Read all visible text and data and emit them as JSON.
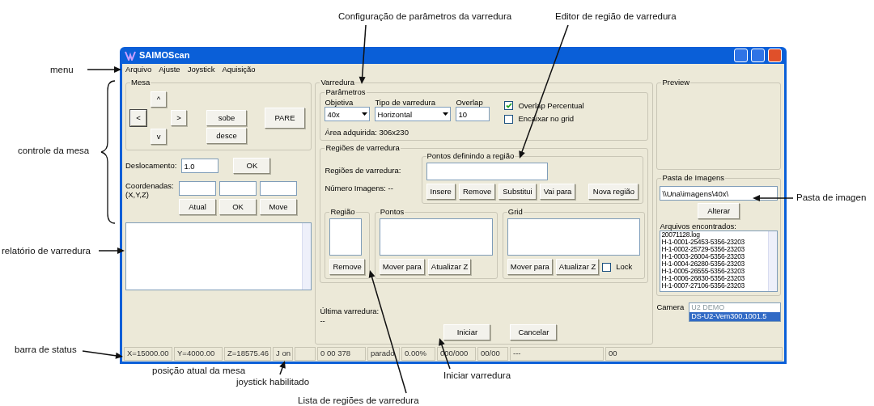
{
  "annotations": [
    {
      "text": "Configuração de parâmetros da varredura"
    },
    {
      "text": "Editor de região de varredura"
    },
    {
      "text": "menu"
    },
    {
      "text": "controle da mesa"
    },
    {
      "text": "relatório de varredura"
    },
    {
      "text": "Pasta de imagen"
    },
    {
      "text": "barra de status"
    },
    {
      "text": "posição atual da mesa"
    },
    {
      "text": "joystick habilitado"
    },
    {
      "text": "Iniciar varredura"
    },
    {
      "text": "Lista de regiões de varredura"
    }
  ],
  "window": {
    "title": "SAIMOScan"
  },
  "menu": [
    "Arquivo",
    "Ajuste",
    "Joystick",
    "Aquisição"
  ],
  "mesa": {
    "title": "Mesa",
    "arrows": [
      "^",
      "<",
      ">",
      "v"
    ],
    "buttons": [
      "sobe",
      "desce",
      "PARE"
    ]
  },
  "deslocamento": {
    "label": "Deslocamento:",
    "value": "1.0",
    "button": "OK"
  },
  "coordenadas": {
    "label": "Coordenadas:",
    "sublabel": "(X,Y,Z)",
    "buttons": [
      "Atual",
      "OK",
      "Move"
    ]
  },
  "varredura": {
    "title": "Varredura",
    "parametros": {
      "title": "Parâmetros",
      "fields": [
        {
          "label": "Objetiva",
          "value": "40x",
          "kind": "select"
        },
        {
          "label": "Tipo de varredura",
          "value": "Horizontal",
          "kind": "select"
        },
        {
          "label": "Overlap",
          "value": "10",
          "kind": "input"
        }
      ],
      "checkboxes": [
        {
          "label": "Overlap Percentual",
          "checked": true
        },
        {
          "label": "Encaixar no grid",
          "checked": false
        }
      ],
      "area": "Área adquirida: 306x230"
    },
    "regioes": {
      "title": "Regiões de varredura",
      "label": "Regiões de varredura:",
      "count": "Número Imagens: --",
      "pontos_definindo": {
        "title": "Pontos definindo a região",
        "buttons": [
          "Insere",
          "Remove",
          "Substitui",
          "Vai para",
          "Nova região"
        ]
      },
      "lists": [
        {
          "title": "Região",
          "buttons": [
            "Remove"
          ]
        },
        {
          "title": "Pontos",
          "buttons": [
            "Mover para",
            "Atualizar Z"
          ]
        },
        {
          "title": "Grid",
          "buttons": [
            "Mover para",
            "Atualizar Z"
          ],
          "lock": {
            "label": "Lock",
            "checked": false
          }
        }
      ]
    },
    "ultima": {
      "label": "Última varredura:",
      "value": "--"
    },
    "buttons": [
      "Iniciar",
      "Cancelar"
    ]
  },
  "preview": {
    "title": "Preview"
  },
  "pasta": {
    "title": "Pasta de Imagens",
    "value": "\\\\Una\\imagens\\40x\\",
    "button": "Alterar",
    "files_label": "Arquivos encontrados:",
    "files": [
      "20071128.log",
      "H-1-0001-25453-5356-23203",
      "H-1-0002-25729-5356-23203",
      "H-1-0003-26004-5356-23203",
      "H-1-0004-26280-5356-23203",
      "H-1-0005-26555-5356-23203",
      "H-1-0006-26830-5356-23203",
      "H-1-0007-27106-5356-23203"
    ]
  },
  "camera": {
    "label": "Camera",
    "items": [
      {
        "text": "U2 DEMO",
        "selected": false
      },
      {
        "text": "DS-U2-Vem300.1001.5",
        "selected": true
      }
    ]
  },
  "status_bar": [
    {
      "text": "X=15000.00"
    },
    {
      "text": "Y=4000.00"
    },
    {
      "text": "Z=18575.46"
    },
    {
      "text": "J on"
    },
    {
      "kind": "empty"
    },
    {
      "text": "0 00 378"
    },
    {
      "text": "parado"
    },
    {
      "text": "0.00%"
    },
    {
      "text": "000/000"
    },
    {
      "text": "00/00"
    },
    {
      "text": "---"
    },
    {
      "text": "00"
    }
  ]
}
